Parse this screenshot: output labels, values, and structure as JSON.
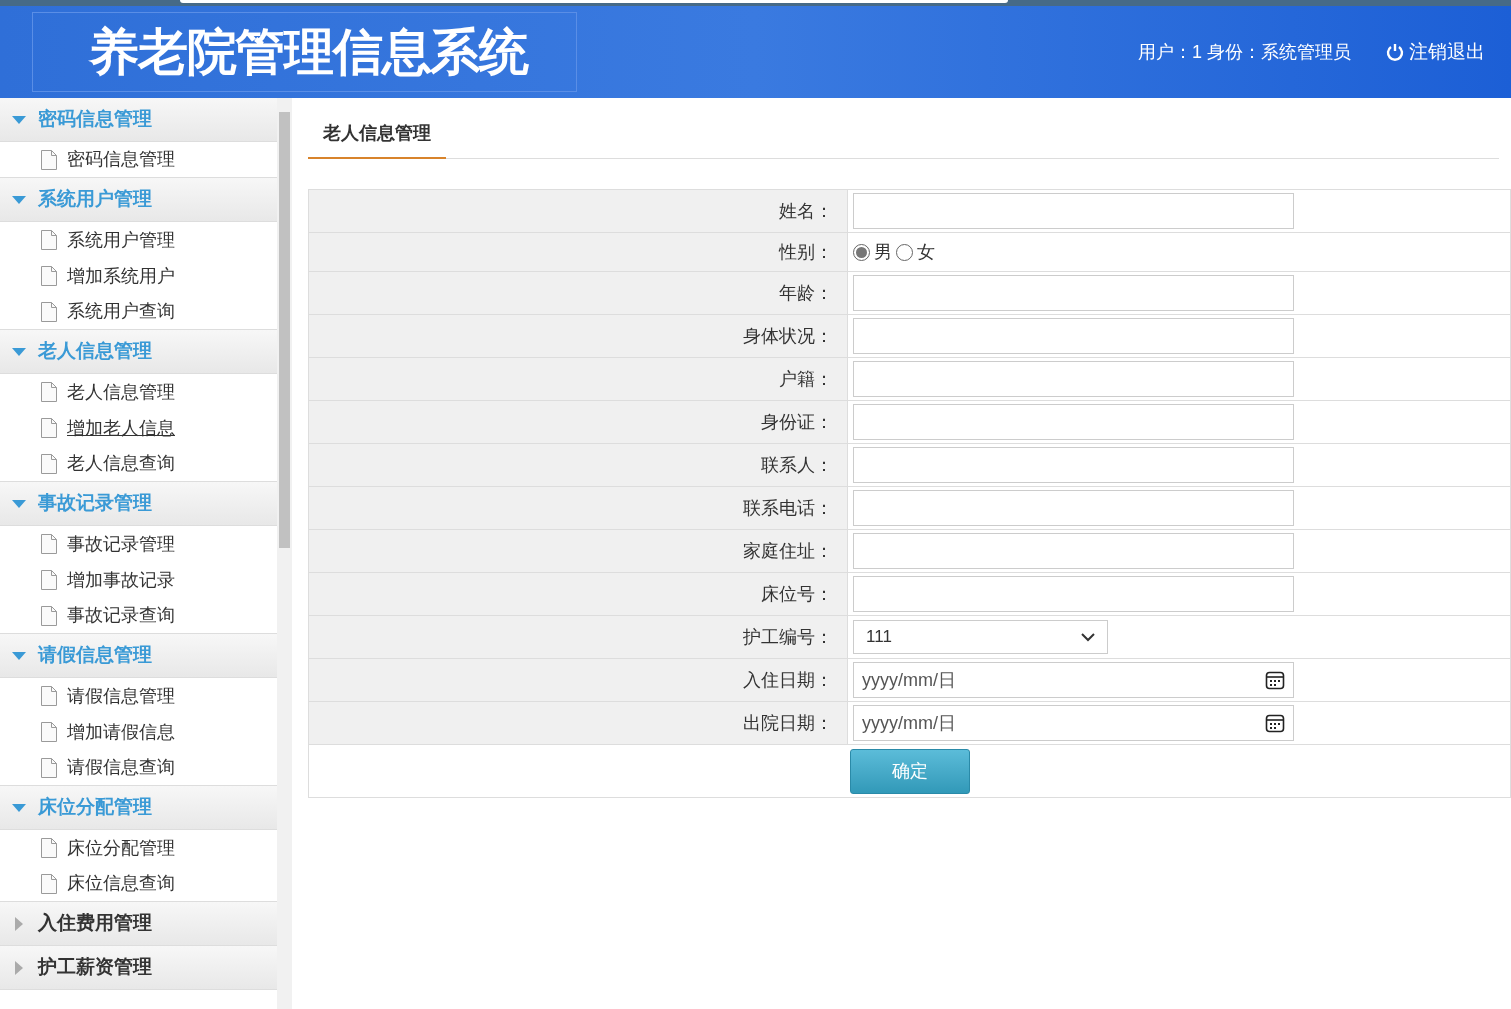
{
  "header": {
    "title": "养老院管理信息系统",
    "user_info": "用户：1 身份：系统管理员",
    "logout": "注销退出"
  },
  "sidebar": {
    "groups": [
      {
        "label": "密码信息管理",
        "expanded": true,
        "items": [
          {
            "label": "密码信息管理",
            "underlined": false
          }
        ]
      },
      {
        "label": "系统用户管理",
        "expanded": true,
        "items": [
          {
            "label": "系统用户管理",
            "underlined": false
          },
          {
            "label": "增加系统用户",
            "underlined": false
          },
          {
            "label": "系统用户查询",
            "underlined": false
          }
        ]
      },
      {
        "label": "老人信息管理",
        "expanded": true,
        "items": [
          {
            "label": "老人信息管理",
            "underlined": false
          },
          {
            "label": "增加老人信息",
            "underlined": true
          },
          {
            "label": "老人信息查询",
            "underlined": false
          }
        ]
      },
      {
        "label": "事故记录管理",
        "expanded": true,
        "items": [
          {
            "label": "事故记录管理",
            "underlined": false
          },
          {
            "label": "增加事故记录",
            "underlined": false
          },
          {
            "label": "事故记录查询",
            "underlined": false
          }
        ]
      },
      {
        "label": "请假信息管理",
        "expanded": true,
        "items": [
          {
            "label": "请假信息管理",
            "underlined": false
          },
          {
            "label": "增加请假信息",
            "underlined": false
          },
          {
            "label": "请假信息查询",
            "underlined": false
          }
        ]
      },
      {
        "label": "床位分配管理",
        "expanded": true,
        "items": [
          {
            "label": "床位分配管理",
            "underlined": false
          },
          {
            "label": "床位信息查询",
            "underlined": false
          }
        ]
      },
      {
        "label": "入住费用管理",
        "expanded": false
      },
      {
        "label": "护工薪资管理",
        "expanded": false
      }
    ]
  },
  "main": {
    "tab": "老人信息管理",
    "form": {
      "fields": [
        {
          "kind": "text",
          "label": "姓名："
        },
        {
          "kind": "radio",
          "label": "性别：",
          "options": [
            {
              "label": "男",
              "selected": true
            },
            {
              "label": "女",
              "selected": false
            }
          ]
        },
        {
          "kind": "text",
          "label": "年龄："
        },
        {
          "kind": "text",
          "label": "身体状况："
        },
        {
          "kind": "text",
          "label": "户籍："
        },
        {
          "kind": "text",
          "label": "身份证："
        },
        {
          "kind": "text",
          "label": "联系人："
        },
        {
          "kind": "text",
          "label": "联系电话："
        },
        {
          "kind": "text",
          "label": "家庭住址："
        },
        {
          "kind": "text",
          "label": "床位号："
        },
        {
          "kind": "select",
          "label": "护工编号：",
          "value": "111"
        },
        {
          "kind": "date",
          "label": "入住日期：",
          "placeholder": "yyyy/mm/日"
        },
        {
          "kind": "date",
          "label": "出院日期：",
          "placeholder": "yyyy/mm/日"
        }
      ],
      "submit": "确定"
    }
  }
}
